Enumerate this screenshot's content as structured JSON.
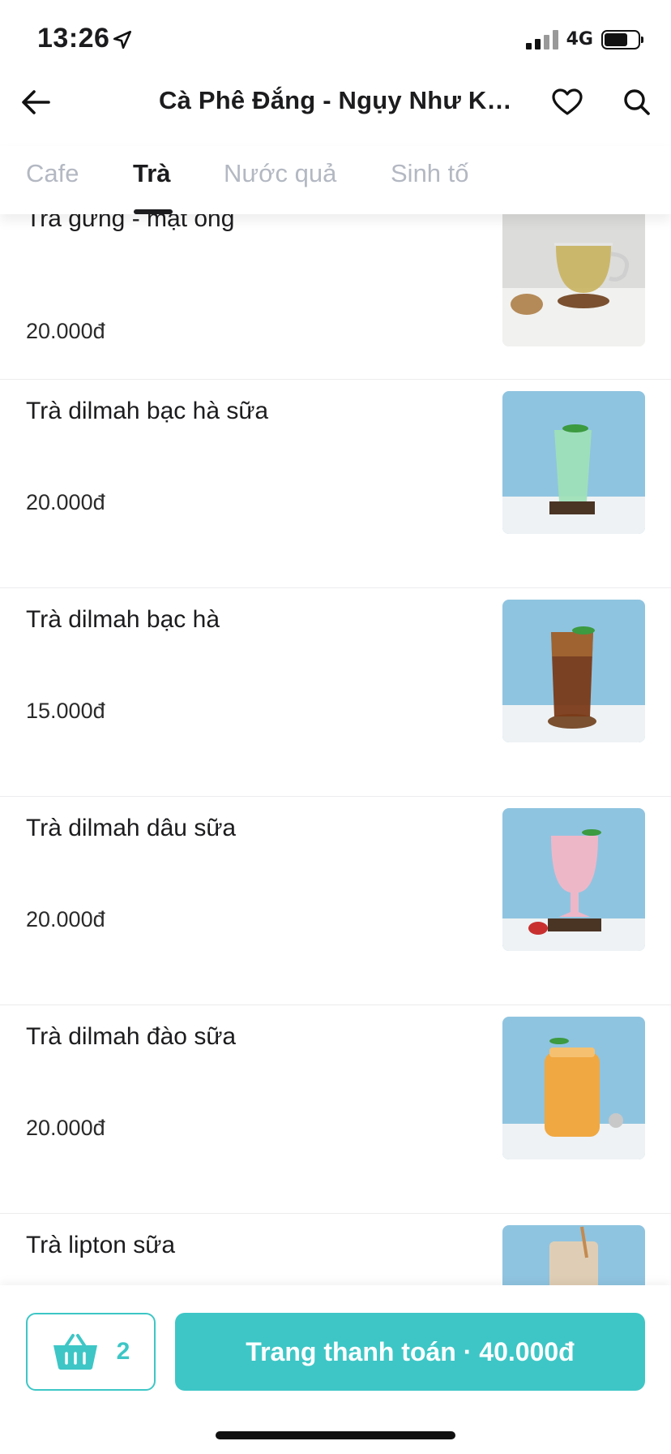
{
  "status": {
    "time": "13:26",
    "network": "4G",
    "battery_level": 0.7
  },
  "header": {
    "title": "Cà Phê Đắng - Ngụy Như Ko..."
  },
  "tabs": [
    {
      "label": "Cafe",
      "active": false
    },
    {
      "label": "Trà",
      "active": true
    },
    {
      "label": "Nước quả",
      "active": false
    },
    {
      "label": "Sinh tố",
      "active": false
    }
  ],
  "items": [
    {
      "name": "Trà gừng - mật ong",
      "price": "20.000đ",
      "image": "ginger-honey-tea-photo"
    },
    {
      "name": "Trà dilmah bạc hà sữa",
      "price": "20.000đ",
      "image": "mint-milk-tea-photo"
    },
    {
      "name": "Trà dilmah bạc hà",
      "price": "15.000đ",
      "image": "mint-tea-photo"
    },
    {
      "name": "Trà dilmah dâu sữa",
      "price": "20.000đ",
      "image": "strawberry-milk-tea-photo"
    },
    {
      "name": "Trà dilmah đào sữa",
      "price": "20.000đ",
      "image": "peach-milk-tea-photo"
    },
    {
      "name": "Trà lipton sữa",
      "price": "",
      "image": "lipton-milk-tea-photo"
    }
  ],
  "cart": {
    "count": "2",
    "checkout_label": "Trang thanh toán · 40.000đ"
  },
  "colors": {
    "accent": "#3ec6c6",
    "inactive_tab": "#b3b8c2",
    "text": "#1c1c1e"
  }
}
